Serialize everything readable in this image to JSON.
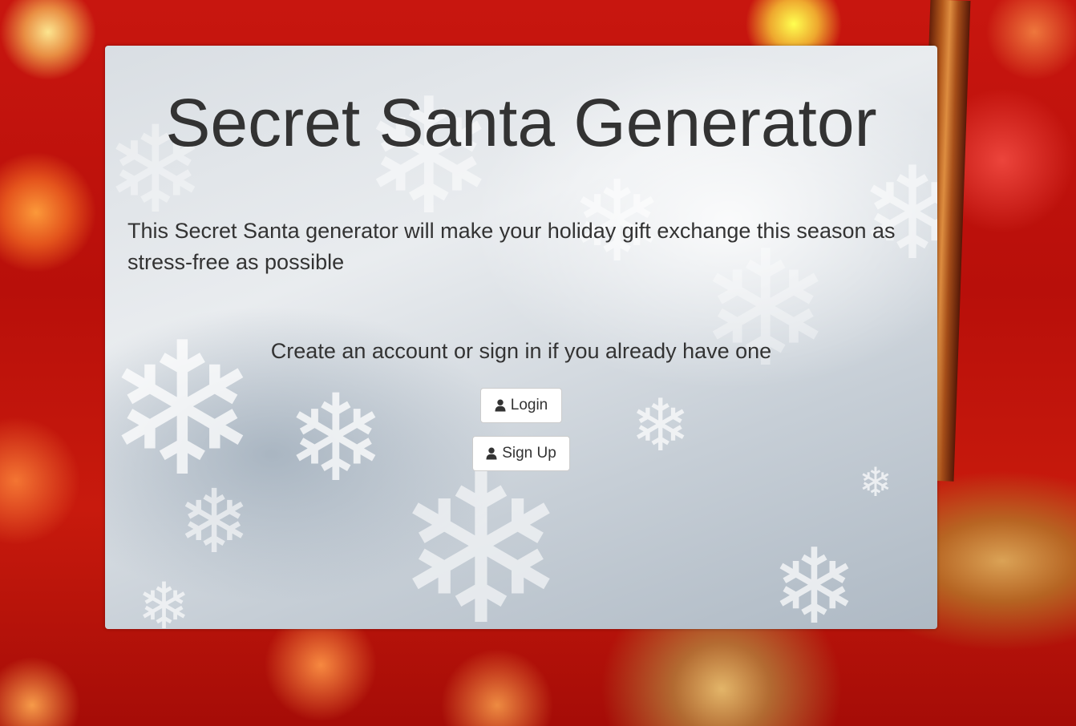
{
  "page": {
    "title": "Secret Santa Generator",
    "description": "This Secret Santa generator will make your holiday gift exchange this season as stress-free as possible",
    "cta_text": "Create an account or sign in if you already have one"
  },
  "buttons": {
    "login_label": "Login",
    "login_icon": "user-icon",
    "signup_label": "Sign Up",
    "signup_icon": "user-icon"
  },
  "colors": {
    "background_accent": "#c8160f",
    "panel": "#e3e7eb",
    "text": "#333333",
    "button_bg": "#ffffff",
    "button_border": "#cccccc"
  }
}
